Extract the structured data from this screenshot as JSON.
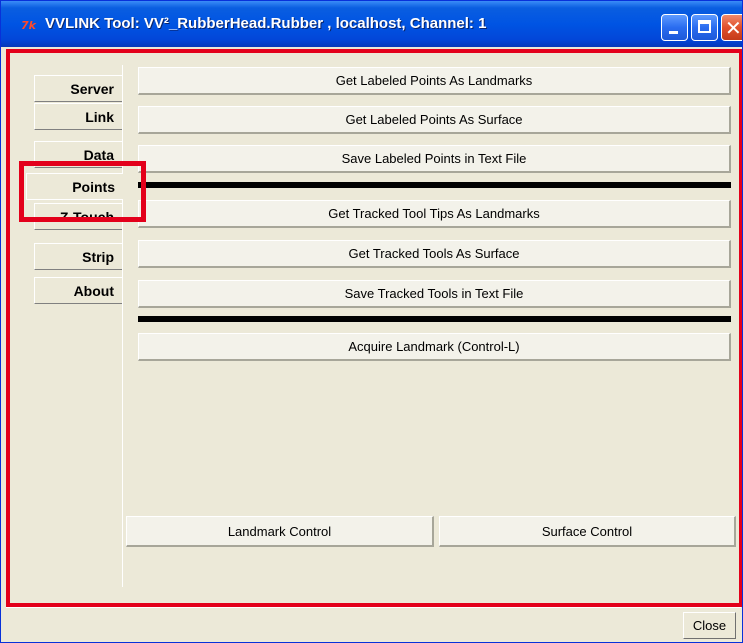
{
  "window": {
    "title": "VVLINK Tool: VV²_RubberHead.Rubber , localhost, Channel: 1",
    "app_icon": "tcl-feather-icon",
    "controls": [
      "minimize",
      "maximize",
      "close"
    ]
  },
  "tabs": {
    "items": [
      {
        "label": "Server"
      },
      {
        "label": "Link"
      },
      {
        "label": "Data"
      },
      {
        "label": "Points"
      },
      {
        "label": "Z-Touch"
      },
      {
        "label": "Strip"
      },
      {
        "label": "About"
      }
    ],
    "selected": "Points"
  },
  "points_panel": {
    "labeled_buttons": [
      {
        "label": "Get Labeled Points As Landmarks"
      },
      {
        "label": "Get Labeled Points As Surface"
      },
      {
        "label": "Save Labeled Points in Text File"
      }
    ],
    "tracked_buttons": [
      {
        "label": "Get Tracked Tool Tips As Landmarks"
      },
      {
        "label": "Get Tracked Tools As Surface"
      },
      {
        "label": "Save Tracked Tools in Text File"
      }
    ],
    "acquire_button": {
      "label": "Acquire Landmark (Control-L)"
    },
    "landmark_control": {
      "label": "Landmark Control"
    },
    "surface_control": {
      "label": "Surface Control"
    }
  },
  "statusbar": {
    "close_label": "Close"
  },
  "colors": {
    "titlebar": "#0054e3",
    "window_bg": "#ece9d8",
    "annotation_red": "#e3001b"
  }
}
